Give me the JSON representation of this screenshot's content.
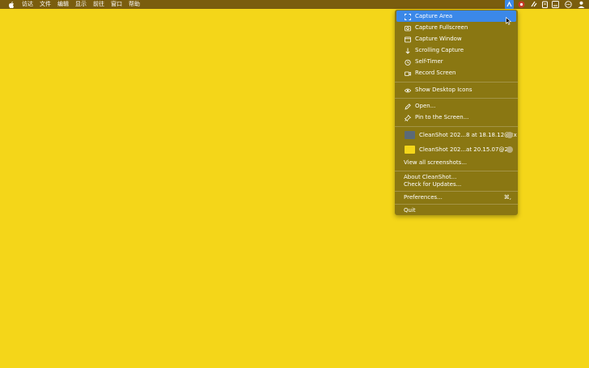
{
  "menubar": {
    "items": [
      "访达",
      "文件",
      "编辑",
      "显示",
      "前往",
      "窗口",
      "帮助"
    ]
  },
  "menu": {
    "capture_area": "Capture Area",
    "capture_fullscreen": "Capture Fullscreen",
    "capture_window": "Capture Window",
    "scrolling_capture": "Scrolling Capture",
    "self_timer": "Self-Timer",
    "record_screen": "Record Screen",
    "show_desktop_icons": "Show Desktop Icons",
    "open": "Open...",
    "pin_to_screen": "Pin to the Screen...",
    "recent": [
      {
        "name": "CleanShot 202...8 at 18.18.12@2x",
        "thumb_color": "#5b6a77"
      },
      {
        "name": "CleanShot 202...at 20.15.07@2x",
        "thumb_color": "#f4d619"
      }
    ],
    "view_all": "View all screenshots...",
    "about": "About CleanShot...",
    "check_updates": "Check for Updates...",
    "preferences": "Preferences...",
    "preferences_shortcut": "⌘,",
    "quit": "Quit"
  },
  "colors": {
    "desktop": "#f4d619",
    "menubar": "#7a5d0e",
    "menu_bg": "#8a7712",
    "highlight": "#3b88e8"
  }
}
